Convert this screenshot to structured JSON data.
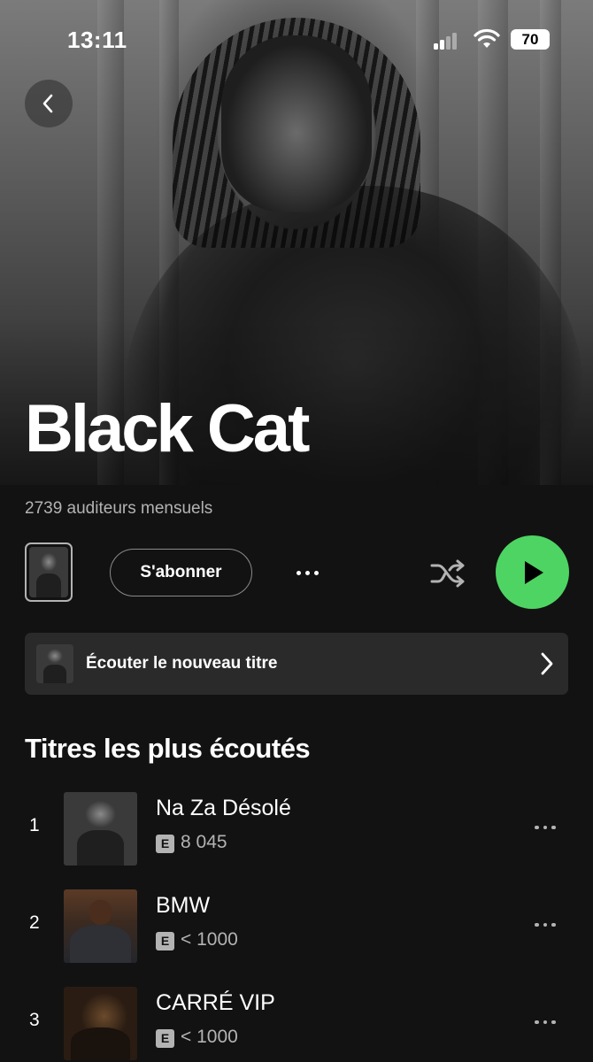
{
  "status_bar": {
    "time": "13:11",
    "battery": "70"
  },
  "artist": {
    "name": "Black Cat",
    "monthly_listeners": "2739 auditeurs mensuels"
  },
  "actions": {
    "follow_label": "S'abonner",
    "play_color": "#4ed463"
  },
  "new_release": {
    "label": "Écouter le nouveau titre"
  },
  "popular": {
    "title": "Titres les plus écoutés",
    "tracks": [
      {
        "rank": "1",
        "title": "Na Za Désolé",
        "explicit": "E",
        "plays": "8 045",
        "cover": "thumb-bw"
      },
      {
        "rank": "2",
        "title": "BMW",
        "explicit": "E",
        "plays": "< 1000",
        "cover": "thumb-hoodie"
      },
      {
        "rank": "3",
        "title": "CARRÉ VIP",
        "explicit": "E",
        "plays": "< 1000",
        "cover": "thumb-gold"
      }
    ]
  },
  "icons": [
    "back-chevron-icon",
    "signal-icon",
    "wifi-icon",
    "battery-icon",
    "more-dots-icon",
    "shuffle-icon",
    "play-icon",
    "chevron-right-icon"
  ]
}
